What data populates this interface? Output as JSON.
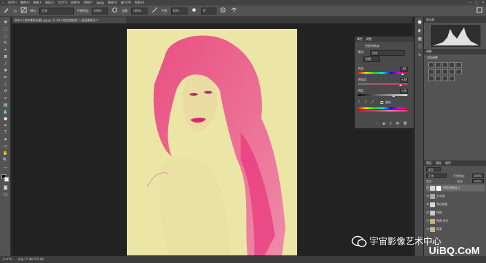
{
  "menu": {
    "logo": "Ps",
    "items": [
      "文件(F)",
      "编辑(E)",
      "图像(I)",
      "图层(L)",
      "文字(Y)",
      "选择(S)",
      "滤镜(T)",
      "3D(D)",
      "视图(V)",
      "窗口(W)",
      "帮助(H)"
    ]
  },
  "window_controls": [
    "—",
    "□",
    "✕"
  ],
  "options": {
    "size": "74",
    "mode_label": "模式:",
    "mode_value": "正常",
    "opacity_label": "不透明度:",
    "opacity_value": "100%",
    "flow_label": "流量:",
    "flow_value": "100%",
    "smooth_label": "平滑:",
    "smooth_value": "10%",
    "angle_value": "0°"
  },
  "document": {
    "tab_title": "368-1-[哈宇素材标题].jpg @ 33.3% (色相/饱和度 1, 图层蒙版/8) *"
  },
  "properties": {
    "tabs": [
      "属性",
      "调整"
    ],
    "title": "色相/饱和度",
    "preset_label": "预设:",
    "preset_value": "自定",
    "channel_value": "全图",
    "hue_label": "色相:",
    "hue_value": "-30",
    "saturation_label": "饱和度:",
    "saturation_value": "+33",
    "lightness_label": "明度:",
    "lightness_value": "+31",
    "colorize_label": "着色"
  },
  "right_panels": {
    "histogram_tab": "直方图",
    "adjustments_tab": "调整",
    "add_adjustment_label": "添加调整",
    "layers_tabs": [
      "图层",
      "通道",
      "路径"
    ],
    "kind_label": "类型",
    "blend_mode": "正常",
    "opacity_label": "不透明度:",
    "opacity_value": "100%",
    "fill_label": "填充:",
    "fill_value": "100%",
    "lock_label": "锁定:"
  },
  "layers": [
    {
      "name": "色相/饱和度 1",
      "selected": true
    },
    {
      "name": "文字组",
      "selected": false
    },
    {
      "name": "黑白效果",
      "selected": false
    },
    {
      "name": "纹理",
      "selected": false
    },
    {
      "name": "图像 拷贝",
      "selected": false
    },
    {
      "name": "背景",
      "selected": false
    }
  ],
  "status": {
    "zoom": "33.87%",
    "doc_info": "文档:17.2M/155.6M"
  },
  "watermark": {
    "text": "宇宙影像艺术中心",
    "brand": "UiBQ.CoM"
  },
  "colors": {
    "canvas_bg": "#ece6a6",
    "hair_pink": "#e8357a",
    "accent_blue": "#31a8ff"
  }
}
